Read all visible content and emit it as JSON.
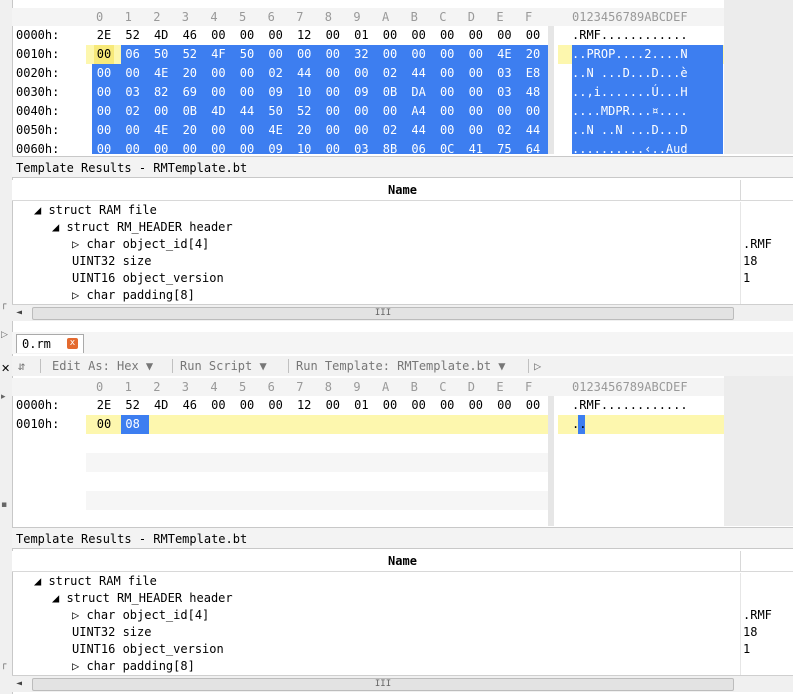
{
  "column_headers": [
    "0",
    "1",
    "2",
    "3",
    "4",
    "5",
    "6",
    "7",
    "8",
    "9",
    "A",
    "B",
    "C",
    "D",
    "E",
    "F"
  ],
  "ascii_header": "0123456789ABCDEF",
  "top_editor": {
    "rows": [
      {
        "addr": "0000h:",
        "bytes": [
          "2E",
          "52",
          "4D",
          "46",
          "00",
          "00",
          "00",
          "12",
          "00",
          "01",
          "00",
          "00",
          "00",
          "00",
          "00",
          "00"
        ],
        "ascii": ".RMF............"
      },
      {
        "addr": "0010h:",
        "bytes": [
          "00",
          "06",
          "50",
          "52",
          "4F",
          "50",
          "00",
          "00",
          "00",
          "32",
          "00",
          "00",
          "00",
          "00",
          "4E",
          "20"
        ],
        "ascii": "..PROP....2....N"
      },
      {
        "addr": "0020h:",
        "bytes": [
          "00",
          "00",
          "4E",
          "20",
          "00",
          "00",
          "02",
          "44",
          "00",
          "00",
          "02",
          "44",
          "00",
          "00",
          "03",
          "E8"
        ],
        "ascii": "..N ...D...D...è"
      },
      {
        "addr": "0030h:",
        "bytes": [
          "00",
          "03",
          "82",
          "69",
          "00",
          "00",
          "09",
          "10",
          "00",
          "09",
          "0B",
          "DA",
          "00",
          "00",
          "03",
          "48"
        ],
        "ascii": "..‚i.......Ú...H"
      },
      {
        "addr": "0040h:",
        "bytes": [
          "00",
          "02",
          "00",
          "0B",
          "4D",
          "44",
          "50",
          "52",
          "00",
          "00",
          "00",
          "A4",
          "00",
          "00",
          "00",
          "00"
        ],
        "ascii": "....MDPR...¤...."
      },
      {
        "addr": "0050h:",
        "bytes": [
          "00",
          "00",
          "4E",
          "20",
          "00",
          "00",
          "4E",
          "20",
          "00",
          "00",
          "02",
          "44",
          "00",
          "00",
          "02",
          "44"
        ],
        "ascii": "..N ..N ...D...D"
      },
      {
        "addr": "0060h:",
        "bytes": [
          "00",
          "00",
          "00",
          "00",
          "00",
          "00",
          "09",
          "10",
          "00",
          "03",
          "8B",
          "06",
          "0C",
          "41",
          "75",
          "64"
        ],
        "ascii": "..........‹..Aud"
      }
    ]
  },
  "top_template": {
    "title": "Template Results - RMTemplate.bt",
    "name_header": "Name",
    "rows": [
      {
        "label": "◢ struct RAM file",
        "value": ""
      },
      {
        "label": "◢ struct RM_HEADER header",
        "value": ""
      },
      {
        "label": "▷ char object_id[4]",
        "value": ".RMF"
      },
      {
        "label": "UINT32 size",
        "value": "18"
      },
      {
        "label": "UINT16 object_version",
        "value": "1"
      },
      {
        "label": "▷ char padding[8]",
        "value": ""
      }
    ],
    "scroll_arrow": "◄",
    "scroll_grip": "III"
  },
  "tab": {
    "label": "0.rm",
    "close": "x"
  },
  "toolbar": {
    "menu_icon": "⇵",
    "edit_as": "Edit As: Hex ▼",
    "run_script": "Run Script ▼",
    "run_template": "Run Template: RMTemplate.bt ▼",
    "play": "▷"
  },
  "bottom_editor": {
    "rows": [
      {
        "addr": "0000h:",
        "bytes": [
          "2E",
          "52",
          "4D",
          "46",
          "00",
          "00",
          "00",
          "12",
          "00",
          "01",
          "00",
          "00",
          "00",
          "00",
          "00",
          "00"
        ],
        "ascii": ".RMF............"
      },
      {
        "addr": "0010h:",
        "bytes": [
          "00",
          "08"
        ],
        "ascii": ".."
      }
    ]
  },
  "bottom_template": {
    "title": "Template Results - RMTemplate.bt",
    "name_header": "Name",
    "rows": [
      {
        "label": "◢ struct RAM file",
        "value": ""
      },
      {
        "label": "◢ struct RM_HEADER header",
        "value": ""
      },
      {
        "label": "▷ char object_id[4]",
        "value": ".RMF"
      },
      {
        "label": "UINT32 size",
        "value": "18"
      },
      {
        "label": "UINT16 object_version",
        "value": "1"
      },
      {
        "label": "▷ char padding[8]",
        "value": ""
      }
    ],
    "scroll_arrow": "◄",
    "scroll_grip": "III"
  },
  "colors": {
    "selection": "#3d7ef0",
    "cursor_row": "#fdf7ae",
    "tab_close": "#e46a2f"
  }
}
